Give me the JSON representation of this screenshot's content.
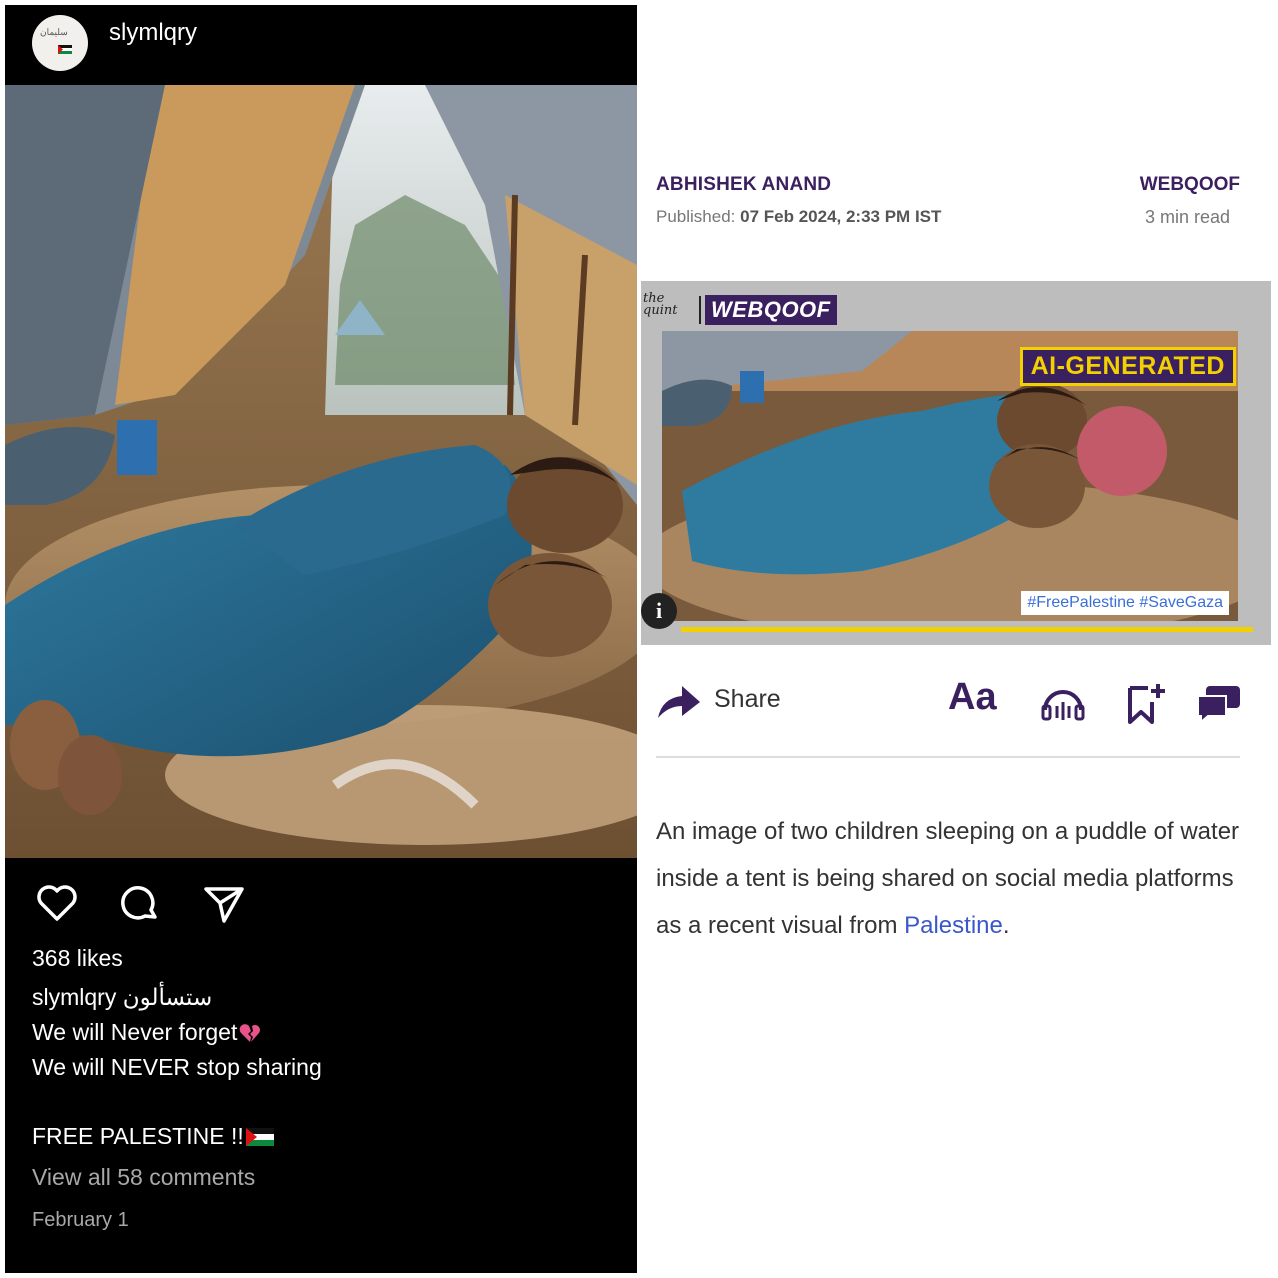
{
  "instagram": {
    "username": "slymlqry",
    "avatar_text": "سليمان",
    "likes": "368 likes",
    "caption_user": "slymlqry",
    "caption_arabic": "ستسألون",
    "caption_line2": "We will Never forget",
    "caption_line3": "We will NEVER stop sharing",
    "caption_line4": "FREE PALESTINE !!",
    "view_comments": "View all 58 comments",
    "date": "February 1",
    "icons": [
      "heart-icon",
      "comment-icon",
      "send-icon",
      "broken-heart-emoji",
      "palestine-flag-emoji"
    ]
  },
  "article": {
    "author": "ABHISHEK ANAND",
    "published_label": "Published:",
    "published_date": "07 Feb 2024, 2:33 PM IST",
    "section": "WEBQOOF",
    "read_time": "3 min read",
    "thumb_brand_small": "the quint",
    "thumb_brand": "WEBQOOF",
    "thumb_badge": "AI-GENERATED",
    "thumb_hashtags": "#FreePalestine #SaveGaza",
    "info_button": "i",
    "share_label": "Share",
    "font_size_label": "Aa",
    "body_text": "An image of two children sleeping on a puddle of water inside a tent is being shared on social media platforms as a recent visual from ",
    "body_link": "Palestine",
    "body_end": ".",
    "toolbar_icons": [
      "share-icon",
      "font-size-icon",
      "listen-icon",
      "bookmark-icon",
      "comments-icon"
    ]
  },
  "colors": {
    "brand_purple": "#3b2060",
    "badge_yellow": "#f3d000",
    "link_blue": "#3a58c8",
    "instagram_bg": "#000000"
  }
}
